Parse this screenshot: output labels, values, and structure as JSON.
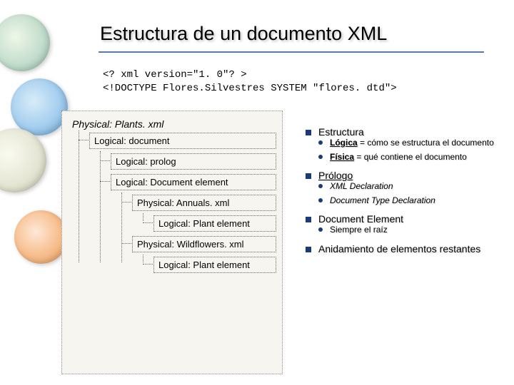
{
  "title": "Estructura de un documento XML",
  "code": {
    "l1": "<? xml version=\"1. 0\"? >",
    "l2": "<!DOCTYPE Flores.Silvestres SYSTEM \"flores. dtd\">"
  },
  "tree": {
    "root": "Physical: Plants. xml",
    "n1": "Logical: document",
    "n2": "Logical: prolog",
    "n3": "Logical: Document element",
    "n4": "Physical: Annuals. xml",
    "n5": "Logical: Plant element",
    "n6": "Physical: Wildflowers. xml",
    "n7": "Logical: Plant element"
  },
  "right": {
    "h1": "Estructura",
    "h1a_b": "Lógica",
    "h1a_t": " = cómo se estructura el documento",
    "h1b_b": "Física",
    "h1b_t": " = qué contiene el documento",
    "h2": "Prólogo",
    "h2a": "XML Declaration",
    "h2b": "Document Type Declaration",
    "h3": "Document Element",
    "h3a": "Siempre el raíz",
    "h4": "Anidamiento de elementos restantes"
  }
}
